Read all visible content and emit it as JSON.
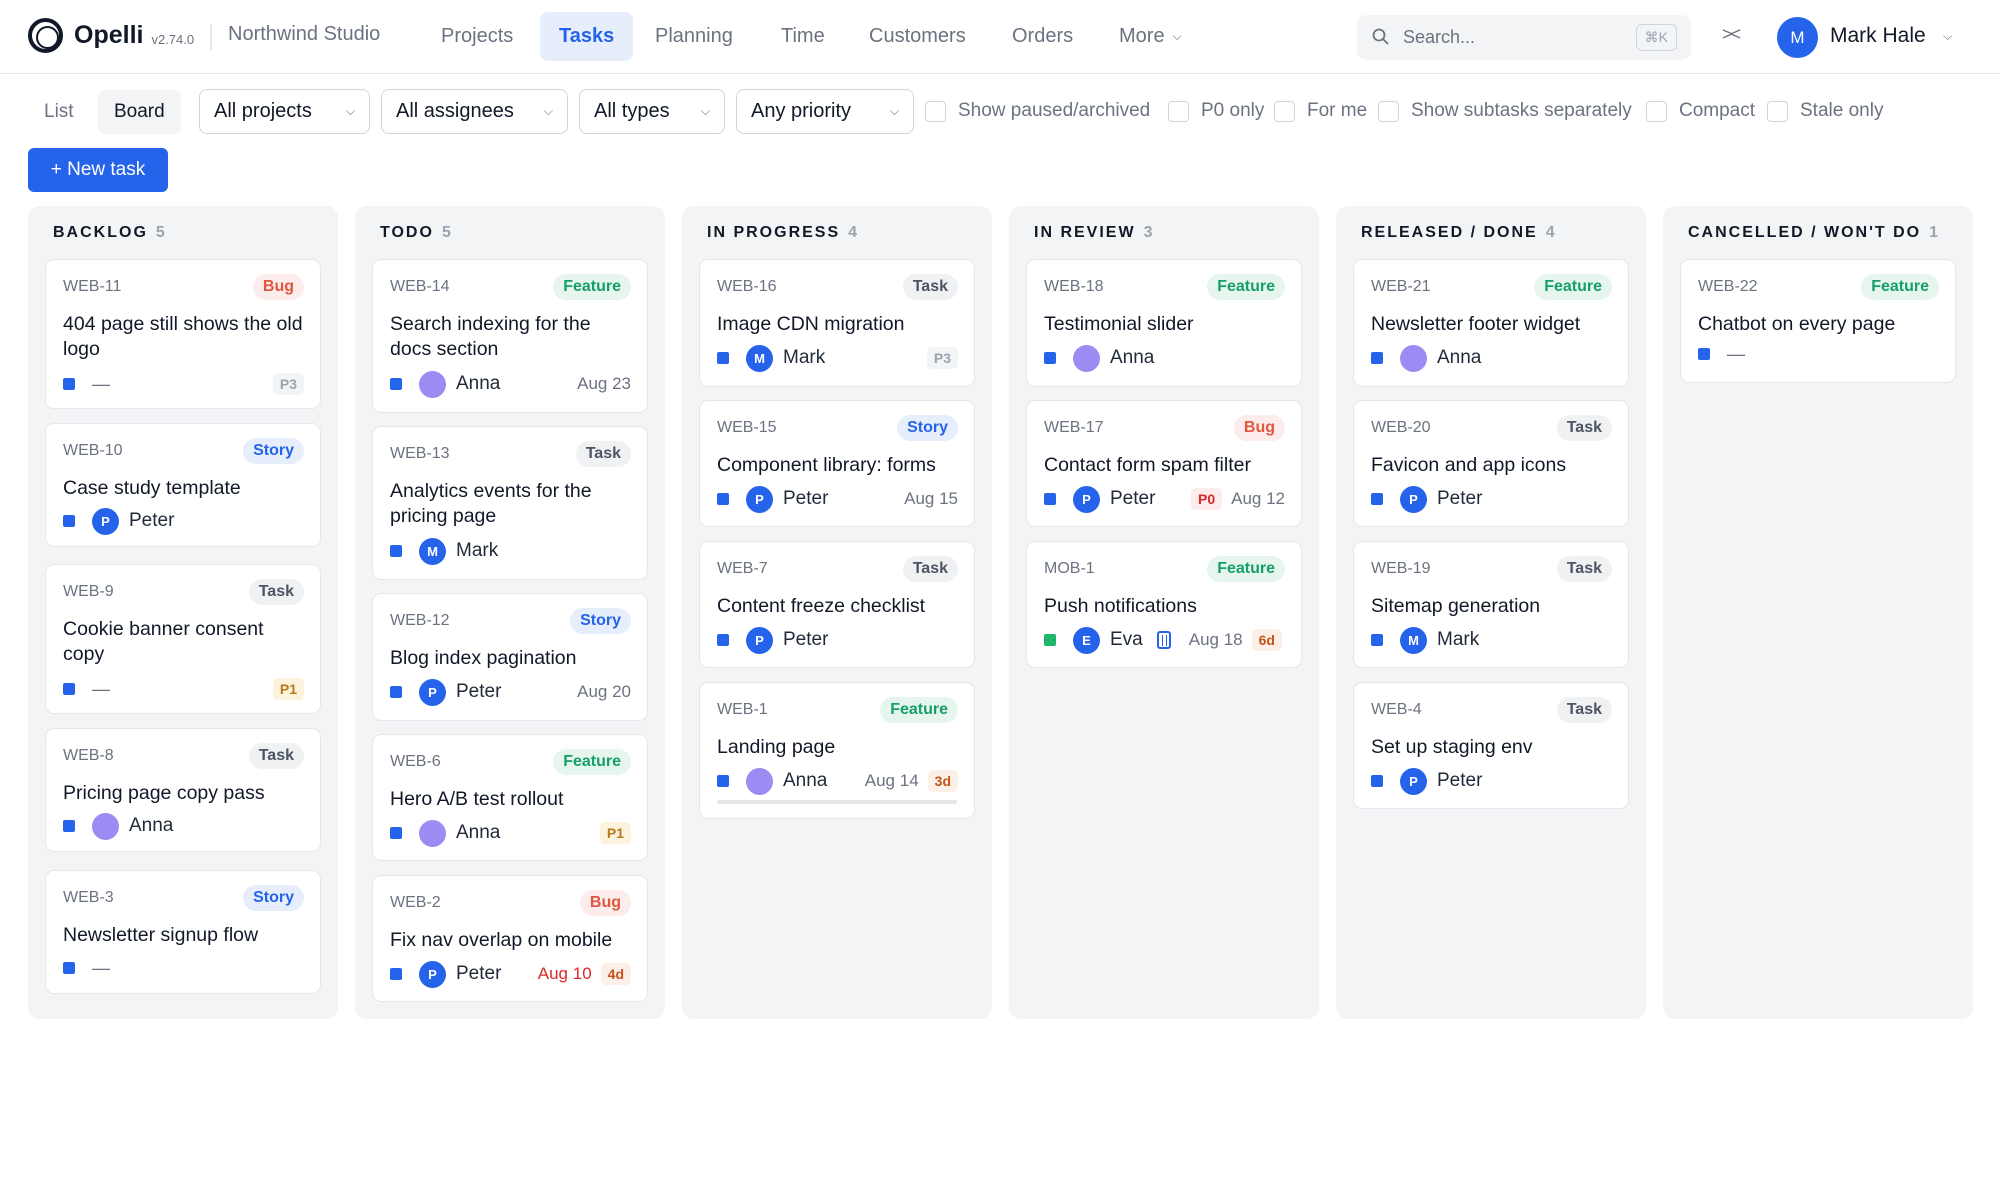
{
  "app": {
    "name": "Opelli",
    "version": "v2.74.0",
    "workspace": "Northwind Studio"
  },
  "nav": {
    "items": [
      {
        "label": "Projects"
      },
      {
        "label": "Tasks"
      },
      {
        "label": "Planning"
      },
      {
        "label": "Time"
      },
      {
        "label": "Customers"
      },
      {
        "label": "Orders"
      },
      {
        "label": "More"
      }
    ],
    "active": "Tasks",
    "search_placeholder": "Search...",
    "search_shortcut": "⌘K",
    "collapse_glyph": "><"
  },
  "user": {
    "name": "Mark Hale",
    "initial": "M"
  },
  "toolbar": {
    "view_tabs": [
      {
        "label": "List"
      },
      {
        "label": "Board"
      }
    ],
    "active_view": "Board",
    "filters": [
      {
        "label": "All projects"
      },
      {
        "label": "All assignees"
      },
      {
        "label": "All types"
      },
      {
        "label": "Any priority"
      }
    ],
    "checkboxes": [
      {
        "label": "Show paused/archived",
        "checked": false
      },
      {
        "label": "P0 only",
        "checked": false
      },
      {
        "label": "For me",
        "checked": false
      },
      {
        "label": "Show subtasks separately",
        "checked": false
      },
      {
        "label": "Compact",
        "checked": false
      },
      {
        "label": "Stale only",
        "checked": false
      }
    ],
    "new_task_label": "+ New task"
  },
  "colors": {
    "accent": "#2563eb",
    "bug": "#e0573f",
    "feature": "#16a067",
    "story": "#2563eb",
    "task": "#4b5563"
  },
  "board": {
    "columns": [
      {
        "title": "BACKLOG",
        "count": "5",
        "cards": [
          {
            "id": "WEB-11",
            "type": "Bug",
            "title": "404 page still shows the old logo",
            "assignee": "—",
            "priority": "P3"
          },
          {
            "id": "WEB-10",
            "type": "Story",
            "title": "Case study template",
            "assignee": "Peter",
            "avatar_initial": "P"
          },
          {
            "id": "WEB-9",
            "type": "Task",
            "title": "Cookie banner consent copy",
            "assignee": "—",
            "priority": "P1"
          },
          {
            "id": "WEB-8",
            "type": "Task",
            "title": "Pricing page copy pass",
            "assignee": "Anna"
          },
          {
            "id": "WEB-3",
            "type": "Story",
            "title": "Newsletter signup flow",
            "assignee": "—"
          }
        ]
      },
      {
        "title": "TODO",
        "count": "5",
        "cards": [
          {
            "id": "WEB-14",
            "type": "Feature",
            "title": "Search indexing for the docs section",
            "assignee": "Anna",
            "date": "Aug 23"
          },
          {
            "id": "WEB-13",
            "type": "Task",
            "title": "Analytics events for the pricing page",
            "assignee": "Mark",
            "avatar_initial": "M"
          },
          {
            "id": "WEB-12",
            "type": "Story",
            "title": "Blog index pagination",
            "assignee": "Peter",
            "avatar_initial": "P",
            "date": "Aug 20"
          },
          {
            "id": "WEB-6",
            "type": "Feature",
            "title": "Hero A/B test rollout",
            "assignee": "Anna",
            "priority": "P1"
          },
          {
            "id": "WEB-2",
            "type": "Bug",
            "title": "Fix nav overlap on mobile",
            "assignee": "Peter",
            "avatar_initial": "P",
            "date": "Aug 10",
            "overdue": true,
            "age": "4d"
          }
        ]
      },
      {
        "title": "IN PROGRESS",
        "count": "4",
        "cards": [
          {
            "id": "WEB-16",
            "type": "Task",
            "title": "Image CDN migration",
            "assignee": "Mark",
            "avatar_initial": "M",
            "priority": "P3"
          },
          {
            "id": "WEB-15",
            "type": "Story",
            "title": "Component library: forms",
            "assignee": "Peter",
            "avatar_initial": "P",
            "date": "Aug 15"
          },
          {
            "id": "WEB-7",
            "type": "Task",
            "title": "Content freeze checklist",
            "assignee": "Peter",
            "avatar_initial": "P"
          },
          {
            "id": "WEB-1",
            "type": "Feature",
            "title": "Landing page",
            "assignee": "Anna",
            "date": "Aug 14",
            "age": "3d",
            "progress": 0
          }
        ]
      },
      {
        "title": "IN REVIEW",
        "count": "3",
        "cards": [
          {
            "id": "WEB-18",
            "type": "Feature",
            "title": "Testimonial slider",
            "assignee": "Anna"
          },
          {
            "id": "WEB-17",
            "type": "Bug",
            "title": "Contact form spam filter",
            "assignee": "Peter",
            "avatar_initial": "P",
            "priority": "P0",
            "date": "Aug 12"
          },
          {
            "id": "MOB-1",
            "type": "Feature",
            "title": "Push notifications",
            "assignee": "Eva",
            "avatar_initial": "E",
            "project_color": "green",
            "blocked": true,
            "date": "Aug 18",
            "age": "6d"
          }
        ]
      },
      {
        "title": "RELEASED / DONE",
        "count": "4",
        "cards": [
          {
            "id": "WEB-21",
            "type": "Feature",
            "title": "Newsletter footer widget",
            "assignee": "Anna"
          },
          {
            "id": "WEB-20",
            "type": "Task",
            "title": "Favicon and app icons",
            "assignee": "Peter",
            "avatar_initial": "P"
          },
          {
            "id": "WEB-19",
            "type": "Task",
            "title": "Sitemap generation",
            "assignee": "Mark",
            "avatar_initial": "M"
          },
          {
            "id": "WEB-4",
            "type": "Task",
            "title": "Set up staging env",
            "assignee": "Peter",
            "avatar_initial": "P"
          }
        ]
      },
      {
        "title": "CANCELLED / WON'T DO",
        "count": "1",
        "cards": [
          {
            "id": "WEB-22",
            "type": "Feature",
            "title": "Chatbot on every page",
            "assignee": "—"
          }
        ]
      }
    ]
  }
}
